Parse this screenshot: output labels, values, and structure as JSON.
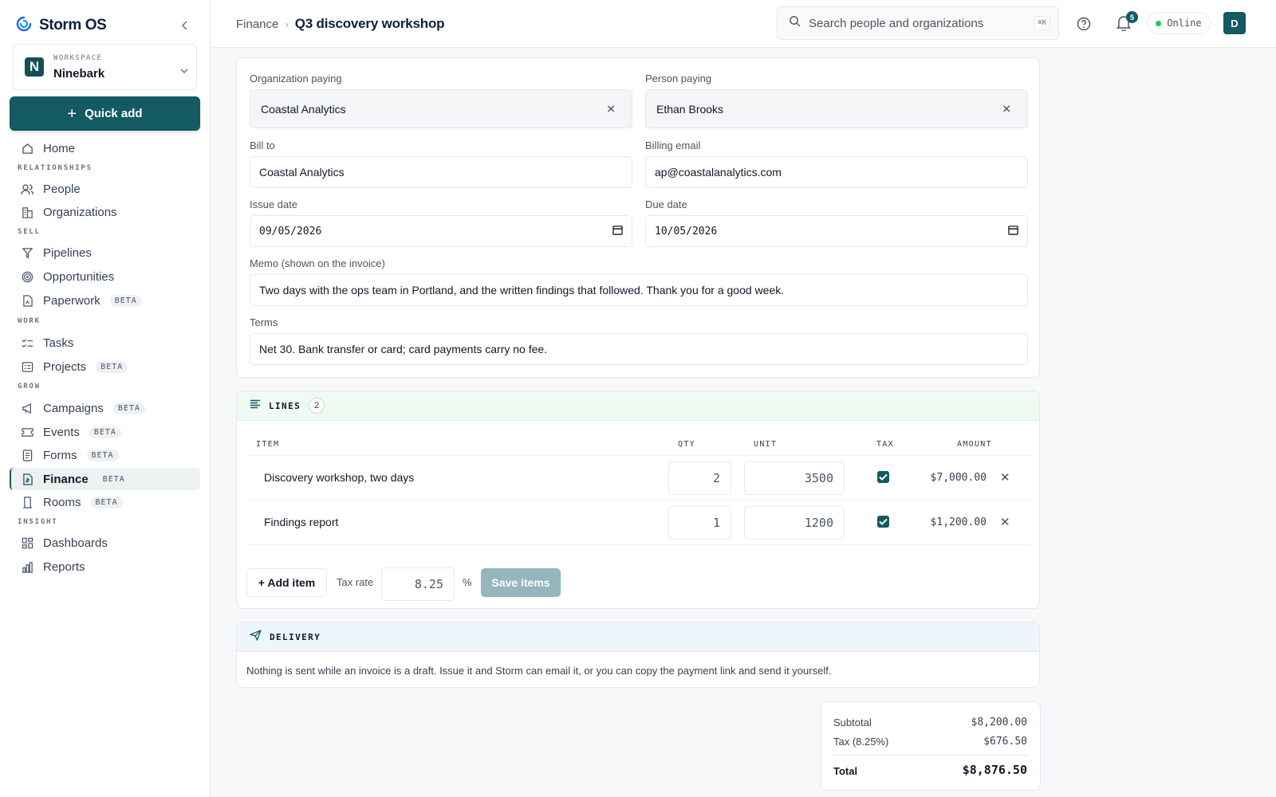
{
  "app": {
    "name": "Storm OS"
  },
  "workspace": {
    "label": "WORKSPACE",
    "name": "Ninebark",
    "initial": "N"
  },
  "quick_add": {
    "label": "Quick add"
  },
  "nav": {
    "home": "Home",
    "sections": {
      "relationships": "RELATIONSHIPS",
      "sell": "SELL",
      "work": "WORK",
      "grow": "GROW",
      "insight": "INSIGHT"
    },
    "items": {
      "people": "People",
      "organizations": "Organizations",
      "pipelines": "Pipelines",
      "opportunities": "Opportunities",
      "paperwork": "Paperwork",
      "tasks": "Tasks",
      "projects": "Projects",
      "campaigns": "Campaigns",
      "events": "Events",
      "forms": "Forms",
      "finance": "Finance",
      "rooms": "Rooms",
      "dashboards": "Dashboards",
      "reports": "Reports"
    },
    "beta": "BETA",
    "active": "finance"
  },
  "breadcrumb": {
    "parent": "Finance",
    "current": "Q3 discovery workshop"
  },
  "search": {
    "placeholder": "Search people and organizations",
    "shortcut": "⌘K"
  },
  "notifications": {
    "count": "5"
  },
  "status": {
    "label": "Online"
  },
  "user": {
    "initial": "D"
  },
  "invoice": {
    "org_paying": {
      "label": "Organization paying",
      "value": "Coastal Analytics"
    },
    "person_paying": {
      "label": "Person paying",
      "value": "Ethan Brooks"
    },
    "bill_to": {
      "label": "Bill to",
      "value": "Coastal Analytics"
    },
    "billing_email": {
      "label": "Billing email",
      "value": "ap@coastalanalytics.com"
    },
    "issue_date": {
      "label": "Issue date",
      "value": "09/05/2026"
    },
    "due_date": {
      "label": "Due date",
      "value": "10/05/2026"
    },
    "memo": {
      "label": "Memo (shown on the invoice)",
      "value": "Two days with the ops team in Portland, and the written findings that followed. Thank you for a good week."
    },
    "terms": {
      "label": "Terms",
      "value": "Net 30. Bank transfer or card; card payments carry no fee."
    }
  },
  "lines": {
    "title": "LINES",
    "count": "2",
    "columns": {
      "item": "ITEM",
      "qty": "QTY",
      "unit": "UNIT",
      "tax": "TAX",
      "amount": "AMOUNT"
    },
    "rows": [
      {
        "item": "Discovery workshop, two days",
        "qty": "2",
        "unit": "3500",
        "tax": true,
        "amount": "$7,000.00"
      },
      {
        "item": "Findings report",
        "qty": "1",
        "unit": "1200",
        "tax": true,
        "amount": "$1,200.00"
      }
    ],
    "add_item": "+ Add item",
    "tax_rate_label": "Tax rate",
    "tax_rate": "8.25",
    "percent": "%",
    "save": "Save items"
  },
  "delivery": {
    "title": "DELIVERY",
    "text": "Nothing is sent while an invoice is a draft. Issue it and Storm can email it, or you can copy the payment link and send it yourself."
  },
  "totals": {
    "subtotal_label": "Subtotal",
    "subtotal": "$8,200.00",
    "tax_label": "Tax (8.25%)",
    "tax": "$676.50",
    "total_label": "Total",
    "total": "$8,876.50"
  },
  "colors": {
    "accent": "#135a63",
    "lines_header": "#effaf3",
    "delivery_header": "#eef6fc"
  }
}
